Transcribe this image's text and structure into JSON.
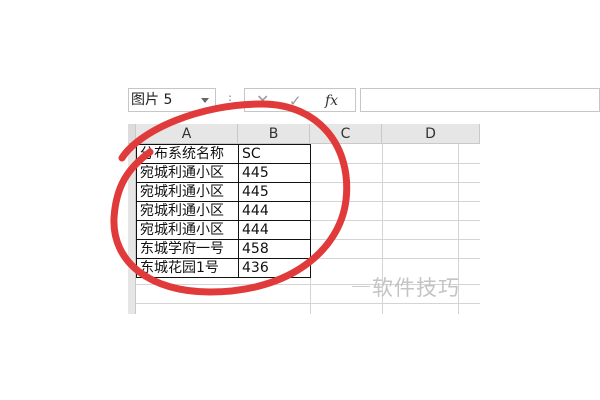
{
  "formula_bar": {
    "name_box": "图片 5",
    "cancel_symbol": "✕",
    "enter_symbol": "✓",
    "fx_label": "fx",
    "formula_value": ""
  },
  "sheet": {
    "columns": [
      "A",
      "B",
      "C",
      "D"
    ],
    "rows": [
      [
        "分布系统名称",
        "SC"
      ],
      [
        "宛城利通小区",
        "445"
      ],
      [
        "宛城利通小区",
        "445"
      ],
      [
        "宛城利通小区",
        "444"
      ],
      [
        "宛城利通小区",
        "444"
      ],
      [
        "东城学府一号",
        "458"
      ],
      [
        "东城花园1号",
        "436"
      ]
    ]
  },
  "annotation": {
    "ring_color": "#e03a3a"
  },
  "watermark": {
    "text": "软件技巧"
  }
}
